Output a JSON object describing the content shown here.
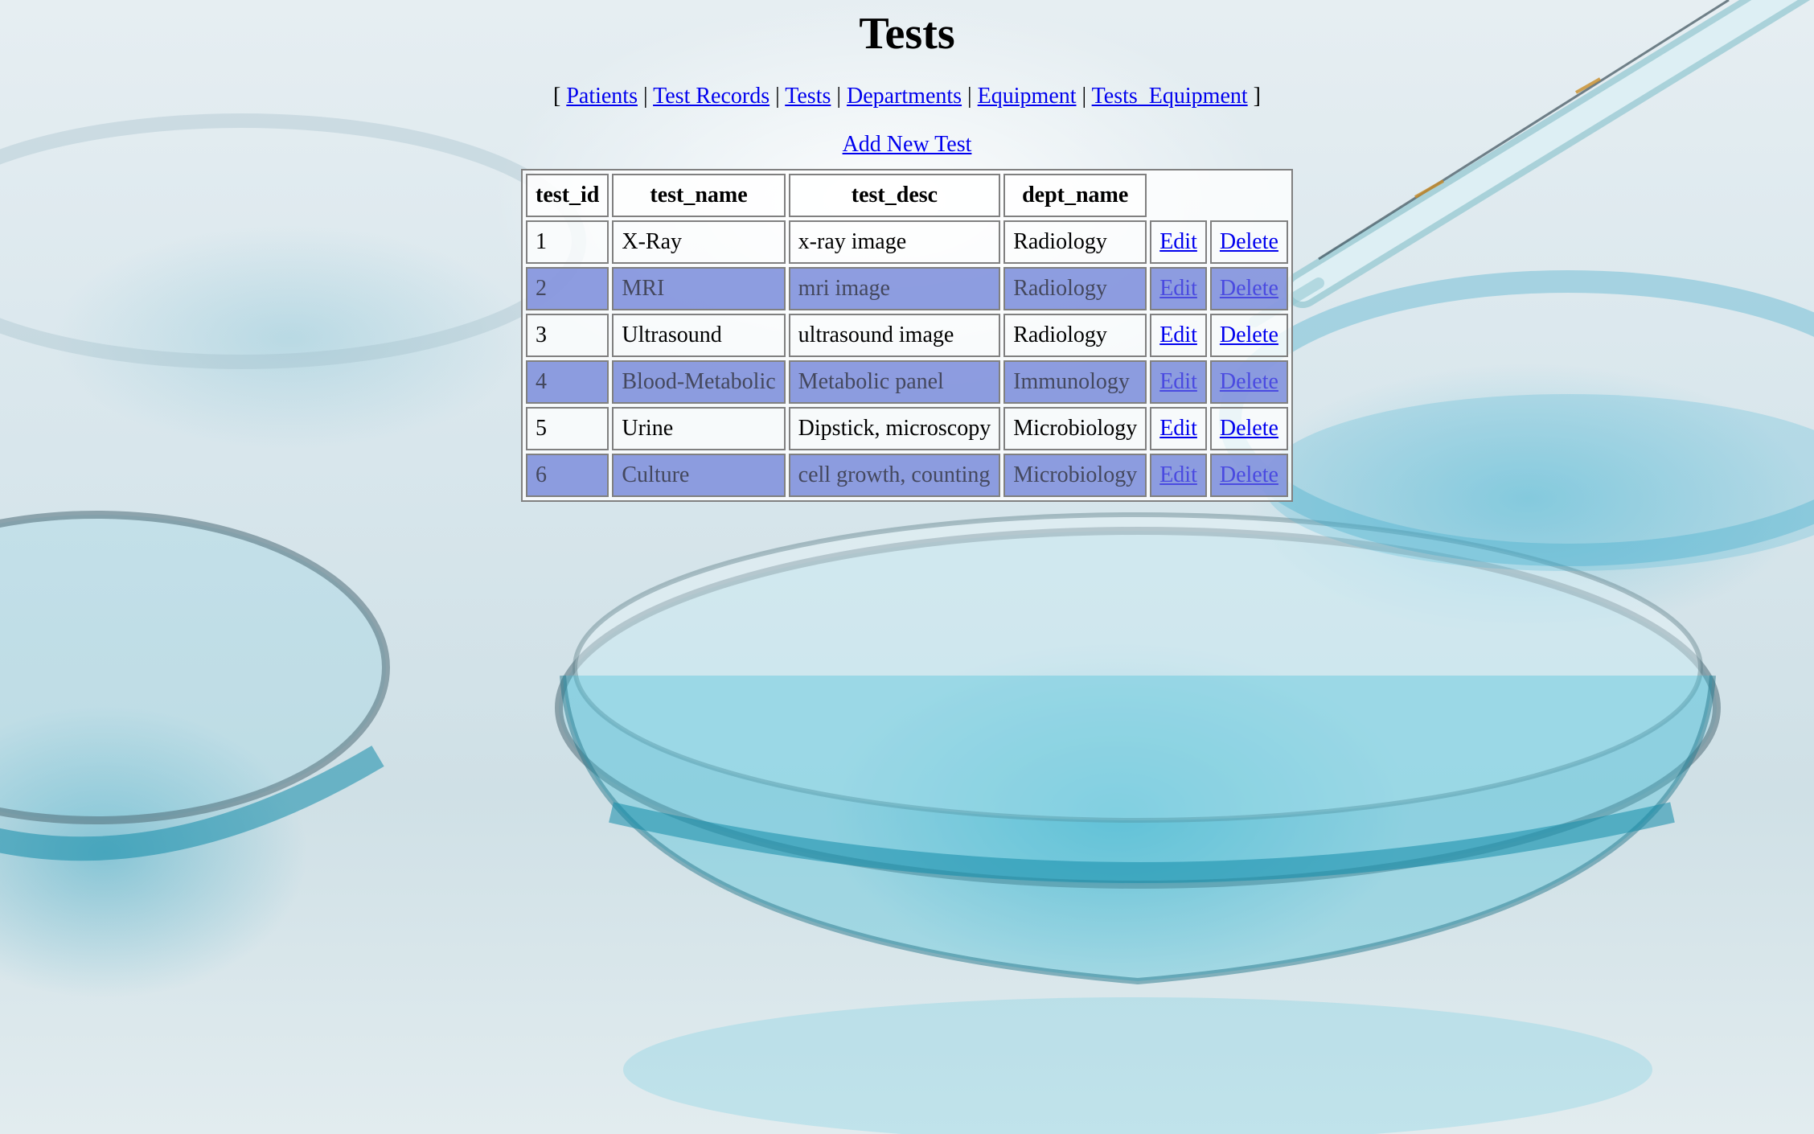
{
  "page": {
    "title": "Tests"
  },
  "nav": {
    "open_bracket": "[",
    "close_bracket": "]",
    "separator": "|",
    "links": [
      "Patients",
      "Test Records",
      "Tests",
      "Departments",
      "Equipment",
      "Tests_Equipment"
    ]
  },
  "add_link": "Add New Test",
  "table": {
    "headers": [
      "test_id",
      "test_name",
      "test_desc",
      "dept_name"
    ],
    "rows": [
      {
        "test_id": "1",
        "test_name": "X-Ray",
        "test_desc": "x-ray image",
        "dept_name": "Radiology",
        "edit": "Edit",
        "delete": "Delete"
      },
      {
        "test_id": "2",
        "test_name": "MRI",
        "test_desc": "mri image",
        "dept_name": "Radiology",
        "edit": "Edit",
        "delete": "Delete"
      },
      {
        "test_id": "3",
        "test_name": "Ultrasound",
        "test_desc": "ultrasound image",
        "dept_name": "Radiology",
        "edit": "Edit",
        "delete": "Delete"
      },
      {
        "test_id": "4",
        "test_name": "Blood-Metabolic",
        "test_desc": "Metabolic panel",
        "dept_name": "Immunology",
        "edit": "Edit",
        "delete": "Delete"
      },
      {
        "test_id": "5",
        "test_name": "Urine",
        "test_desc": "Dipstick, microscopy",
        "dept_name": "Microbiology",
        "edit": "Edit",
        "delete": "Delete"
      },
      {
        "test_id": "6",
        "test_name": "Culture",
        "test_desc": "cell growth, counting",
        "dept_name": "Microbiology",
        "edit": "Edit",
        "delete": "Delete"
      }
    ]
  },
  "colors": {
    "link": "#0000ee",
    "alt_row": "#8a9bdc",
    "border": "#808080"
  },
  "background": {
    "icon": "petri-dish-pipette-photo"
  }
}
